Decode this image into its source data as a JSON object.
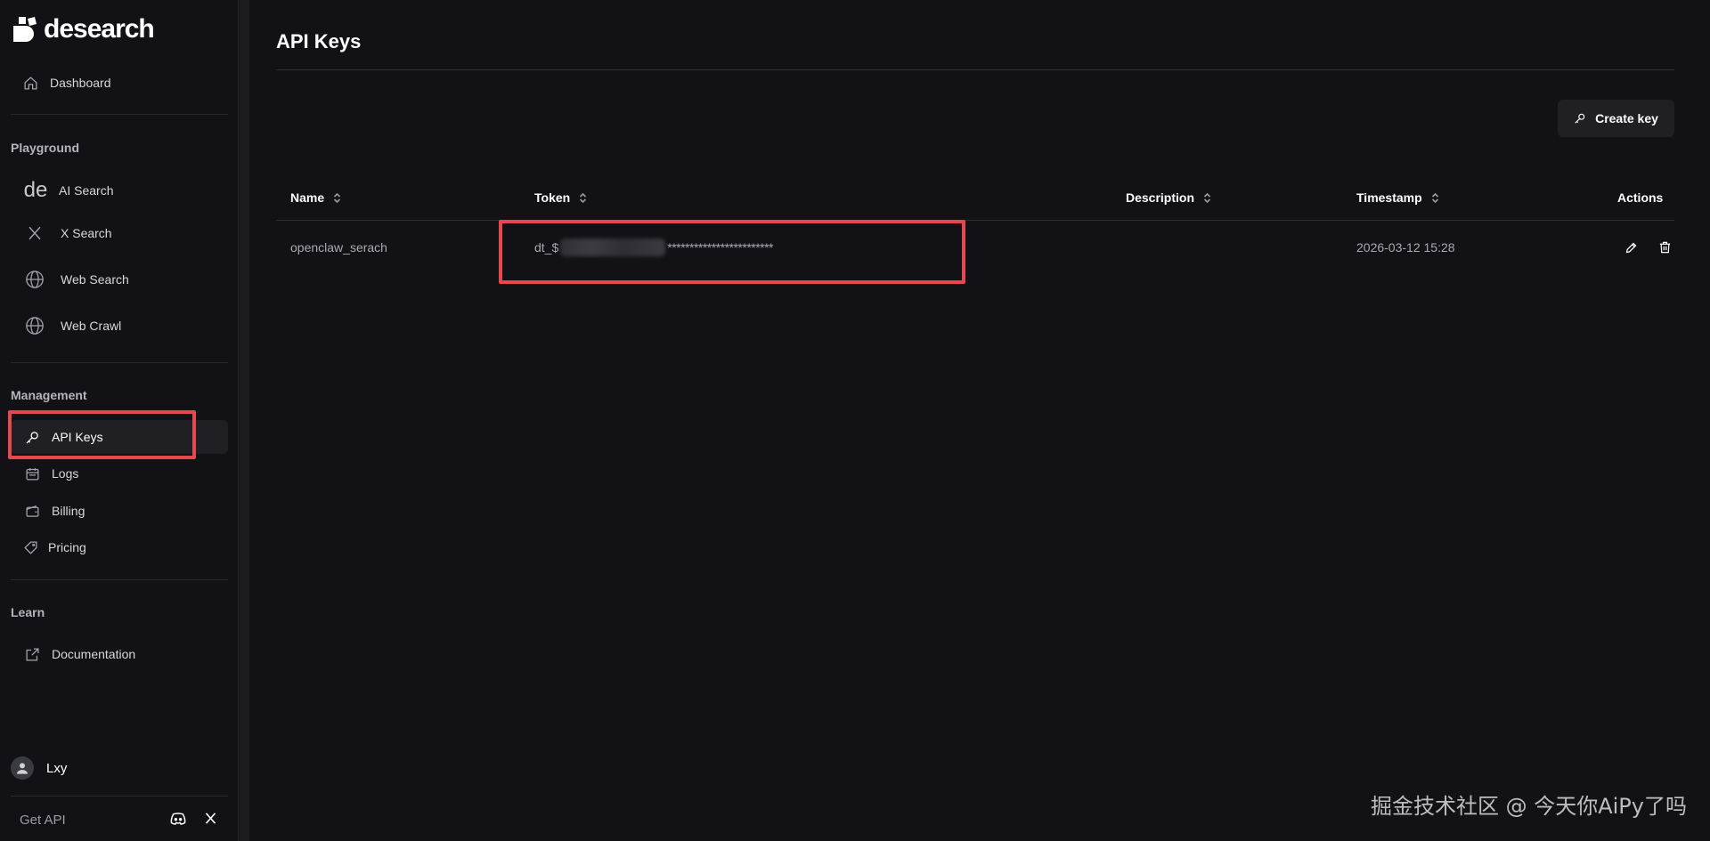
{
  "app": {
    "logo_text": "desearch"
  },
  "sidebar": {
    "dashboard": "Dashboard",
    "sections": {
      "playground": "Playground",
      "management": "Management",
      "learn": "Learn"
    },
    "playground_items": [
      "AI Search",
      "X Search",
      "Web Search",
      "Web Crawl"
    ],
    "management_items": [
      "API Keys",
      "Logs",
      "Billing",
      "Pricing"
    ],
    "learn_items": [
      "Documentation"
    ],
    "user": {
      "name": "Lxy"
    },
    "footer": {
      "get_api": "Get API"
    }
  },
  "main": {
    "title": "API Keys",
    "create_button": "Create key",
    "table": {
      "headers": [
        "Name",
        "Token",
        "Description",
        "Timestamp",
        "Actions"
      ],
      "rows": [
        {
          "name": "openclaw_serach",
          "token_prefix": "dt_$",
          "token_masked": "************************",
          "description": "",
          "timestamp": "2026-03-12 15:28"
        }
      ]
    }
  },
  "watermark": "掘金技术社区 @ 今天你AiPy了吗",
  "colors": {
    "highlight": "#e5484d",
    "background": "#121216",
    "active_item": "#1f1f24"
  }
}
